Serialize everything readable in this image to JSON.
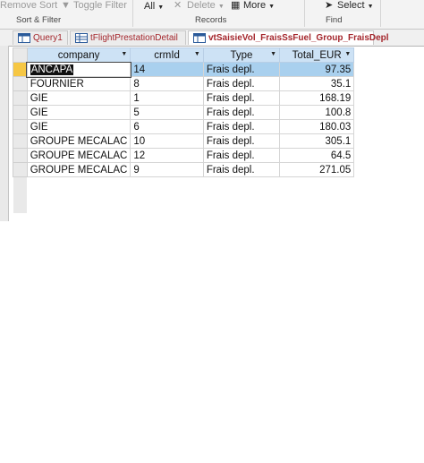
{
  "ribbon": {
    "remove_sort": "Remove Sort",
    "toggle_filter": "Toggle Filter",
    "all": "All",
    "delete": "Delete",
    "more": "More",
    "select": "Select",
    "group_sort_filter": "Sort & Filter",
    "group_records": "Records",
    "group_find": "Find"
  },
  "tabs": [
    {
      "label": "Query1",
      "icon": "query-icon"
    },
    {
      "label": "tFlightPrestationDetail",
      "icon": "table-icon"
    },
    {
      "label": "vtSaisieVol_FraisSsFuel_Group_FraisDepl",
      "icon": "query-icon"
    }
  ],
  "table": {
    "columns": [
      "company",
      "crmId",
      "Type",
      "Total_EUR"
    ],
    "rows": [
      [
        "ANCAPA",
        "14",
        "Frais depl.",
        "97.35"
      ],
      [
        "FOURNIER",
        "8",
        "Frais depl.",
        "35.1"
      ],
      [
        "GIE",
        "1",
        "Frais depl.",
        "168.19"
      ],
      [
        "GIE",
        "5",
        "Frais depl.",
        "100.8"
      ],
      [
        "GIE",
        "6",
        "Frais depl.",
        "180.03"
      ],
      [
        "GROUPE MECALAC",
        "10",
        "Frais depl.",
        "305.1"
      ],
      [
        "GROUPE MECALAC",
        "12",
        "Frais depl.",
        "64.5"
      ],
      [
        "GROUPE MECALAC",
        "9",
        "Frais depl.",
        "271.05"
      ]
    ]
  },
  "colors": {
    "header_bg": "#cde2f5",
    "current_row": "#a9d0ee",
    "record_selector_active": "#f6c744",
    "tab_text": "#a4262c"
  }
}
